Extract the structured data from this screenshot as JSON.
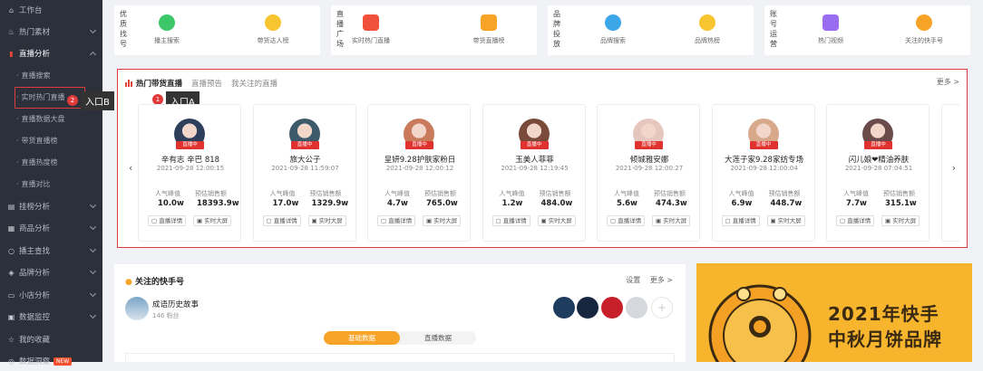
{
  "sidebar": {
    "items": [
      {
        "label": "工作台",
        "icon": "home-icon"
      },
      {
        "label": "热门素材",
        "icon": "flame-icon"
      },
      {
        "label": "直播分析",
        "icon": "chart-icon"
      },
      {
        "label": "挂榜分析",
        "icon": "list-icon"
      },
      {
        "label": "商品分析",
        "icon": "cart-icon"
      },
      {
        "label": "播主查找",
        "icon": "search-icon"
      },
      {
        "label": "品牌分析",
        "icon": "tag-icon"
      },
      {
        "label": "小店分析",
        "icon": "store-icon"
      },
      {
        "label": "数据监控",
        "icon": "monitor-icon"
      },
      {
        "label": "我的收藏",
        "icon": "star-icon"
      },
      {
        "label": "数据洞察",
        "icon": "insight-icon",
        "badge": "NEW"
      }
    ],
    "subitems": [
      "直播搜索",
      "实时热门直播",
      "直播数据大盘",
      "带货直播榜",
      "直播热度榜",
      "直播对比"
    ]
  },
  "annotations": {
    "badge1": "1",
    "badge2": "2",
    "entry_a": "入口A",
    "entry_b": "入口B"
  },
  "categories": [
    {
      "title": "优质找号",
      "items": [
        "播主搜索",
        "带货达人榜"
      ]
    },
    {
      "title": "直播广场",
      "items": [
        "实时热门直播",
        "带货直播榜"
      ]
    },
    {
      "title": "品牌投放",
      "items": [
        "品牌搜索",
        "品牌热榜"
      ]
    },
    {
      "title": "账号运营",
      "items": [
        "热门视频",
        "关注的快手号"
      ]
    }
  ],
  "hot": {
    "tabs": [
      "热门带货直播",
      "直播预告",
      "我关注的直播"
    ],
    "more": "更多 >",
    "live_tag": "直播中",
    "labels": {
      "popularity": "人气峰值",
      "sales": "预估销售额"
    },
    "buttons": {
      "detail": "直播详情",
      "screen": "实时大屏"
    },
    "streamers": [
      {
        "name": "辛有志 辛巴 818",
        "time": "2021-09-28 12:00:15",
        "popularity": "10.0w",
        "sales": "18393.9w"
      },
      {
        "name": "旅大公子",
        "time": "2021-09-28 11:59:07",
        "popularity": "17.0w",
        "sales": "1329.9w"
      },
      {
        "name": "呈妍9.28护肤家粉日",
        "time": "2021-09-28 12:00:12",
        "popularity": "4.7w",
        "sales": "765.0w"
      },
      {
        "name": "玉美人菲菲",
        "time": "2021-09-28 12:19:45",
        "popularity": "1.2w",
        "sales": "484.0w"
      },
      {
        "name": "倾城雅安娜",
        "time": "2021-09-28 12:00:27",
        "popularity": "5.6w",
        "sales": "474.3w"
      },
      {
        "name": "大莲子家9.28家纺专场",
        "time": "2021-09-28 12:00:04",
        "popularity": "6.9w",
        "sales": "448.7w"
      },
      {
        "name": "闪儿娘❤精油养肤",
        "time": "2021-09-28 07:04:51",
        "popularity": "7.7w",
        "sales": "315.1w"
      }
    ]
  },
  "follow": {
    "title": "关注的快手号",
    "settings": "设置",
    "more": "更多 >",
    "account_name": "成语历史故事",
    "fans": "146 粉丝",
    "tab_on": "基础数据",
    "tab_off": "直播数据"
  },
  "banner": {
    "line1": "2021年快手",
    "line2": "中秋月饼品牌"
  }
}
